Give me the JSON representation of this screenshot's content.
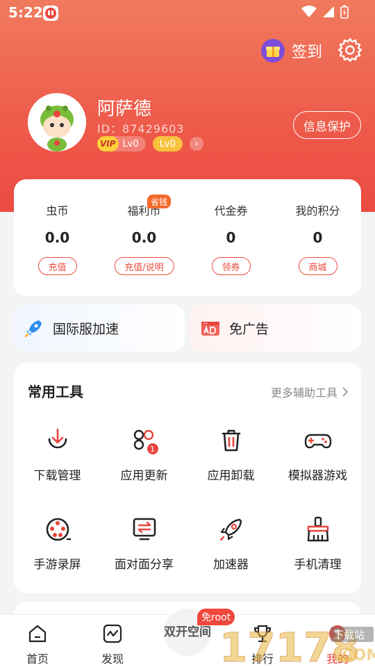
{
  "status_bar": {
    "time": "5:22"
  },
  "header": {
    "checkin_label": "签到",
    "user_name": "阿萨德",
    "user_id": "ID：87429603",
    "vip_tag": "VIP",
    "vip_level": "Lv0",
    "level": "Lv0",
    "privacy_button": "信息保护"
  },
  "wallet": {
    "save_tag": "省钱",
    "items": [
      {
        "label": "虫币",
        "value": "0.0",
        "button": "充值"
      },
      {
        "label": "福利币",
        "value": "0.0",
        "button": "充值/说明"
      },
      {
        "label": "代金券",
        "value": "0",
        "button": "领券"
      },
      {
        "label": "我的积分",
        "value": "0",
        "button": "商城"
      }
    ]
  },
  "promos": [
    {
      "label": "国际服加速",
      "icon": "rocket-icon"
    },
    {
      "label": "免广告",
      "icon": "ad-icon"
    }
  ],
  "tools": {
    "title": "常用工具",
    "more": "更多辅助工具",
    "items": [
      {
        "label": "下载管理",
        "icon": "download-icon"
      },
      {
        "label": "应用更新",
        "icon": "apps-update-icon",
        "badge": "1"
      },
      {
        "label": "应用卸载",
        "icon": "trash-icon"
      },
      {
        "label": "模拟器游戏",
        "icon": "gamepad-icon"
      },
      {
        "label": "手游录屏",
        "icon": "film-reel-icon"
      },
      {
        "label": "面对面分享",
        "icon": "share-transfer-icon"
      },
      {
        "label": "加速器",
        "icon": "rocket-icon"
      },
      {
        "label": "手机清理",
        "icon": "broom-icon"
      }
    ]
  },
  "tabbar": {
    "center_label": "双开空间",
    "root_tag": "免root",
    "items": [
      {
        "label": "首页",
        "icon": "home-icon"
      },
      {
        "label": "发现",
        "icon": "discover-icon"
      },
      {
        "label": "排行",
        "icon": "trophy-icon"
      },
      {
        "label": "我的",
        "icon": "profile-icon"
      }
    ]
  },
  "watermark": {
    "text": "17178",
    "sub": "下载站",
    "domain": ".COM"
  },
  "colors": {
    "accent": "#e8453c",
    "header_top": "#f07a5e",
    "header_bottom": "#ec4b41",
    "gold": "#f8c23f"
  }
}
